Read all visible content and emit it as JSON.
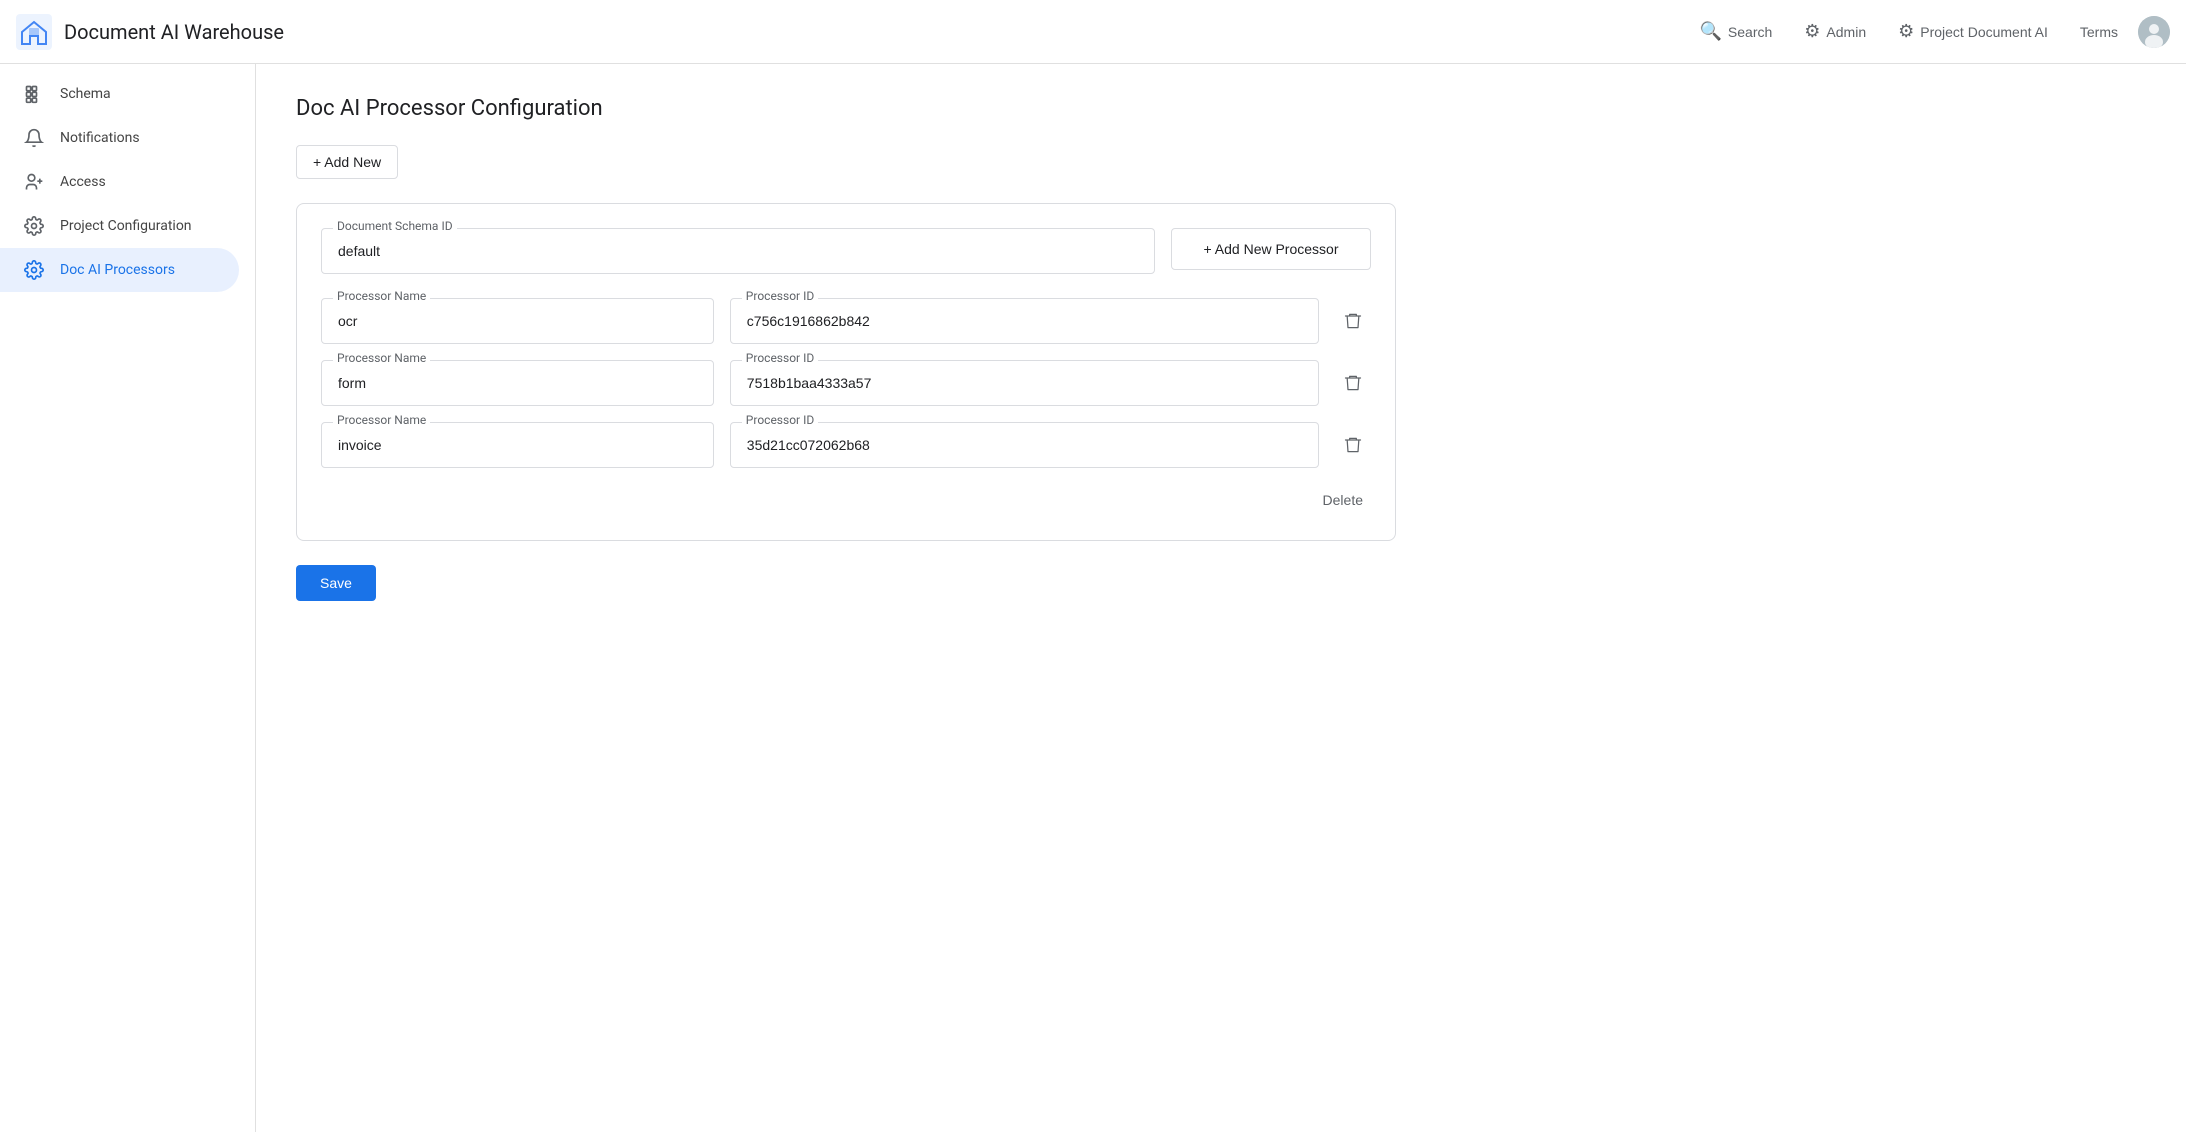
{
  "app": {
    "title": "Document AI Warehouse",
    "logo_alt": "Document AI Warehouse logo"
  },
  "top_nav": {
    "search_label": "Search",
    "admin_label": "Admin",
    "project_label": "Project Document AI",
    "terms_label": "Terms"
  },
  "sidebar": {
    "items": [
      {
        "id": "schema",
        "label": "Schema",
        "icon": "schema"
      },
      {
        "id": "notifications",
        "label": "Notifications",
        "icon": "bell"
      },
      {
        "id": "access",
        "label": "Access",
        "icon": "access"
      },
      {
        "id": "project-configuration",
        "label": "Project Configuration",
        "icon": "settings"
      },
      {
        "id": "doc-ai-processors",
        "label": "Doc AI Processors",
        "icon": "settings2",
        "active": true
      }
    ]
  },
  "main": {
    "page_title": "Doc AI Processor Configuration",
    "add_new_label": "+ Add New",
    "document_schema_id_label": "Document Schema ID",
    "document_schema_id_value": "default",
    "add_new_processor_label": "+ Add New Processor",
    "processors": [
      {
        "name_label": "Processor Name",
        "name_value": "ocr",
        "id_label": "Processor ID",
        "id_value": "c756c1916862b842"
      },
      {
        "name_label": "Processor Name",
        "name_value": "form",
        "id_label": "Processor ID",
        "id_value": "7518b1baa4333a57"
      },
      {
        "name_label": "Processor Name",
        "name_value": "invoice",
        "id_label": "Processor ID",
        "id_value": "35d21cc072062b68"
      }
    ],
    "delete_label": "Delete",
    "save_label": "Save"
  }
}
